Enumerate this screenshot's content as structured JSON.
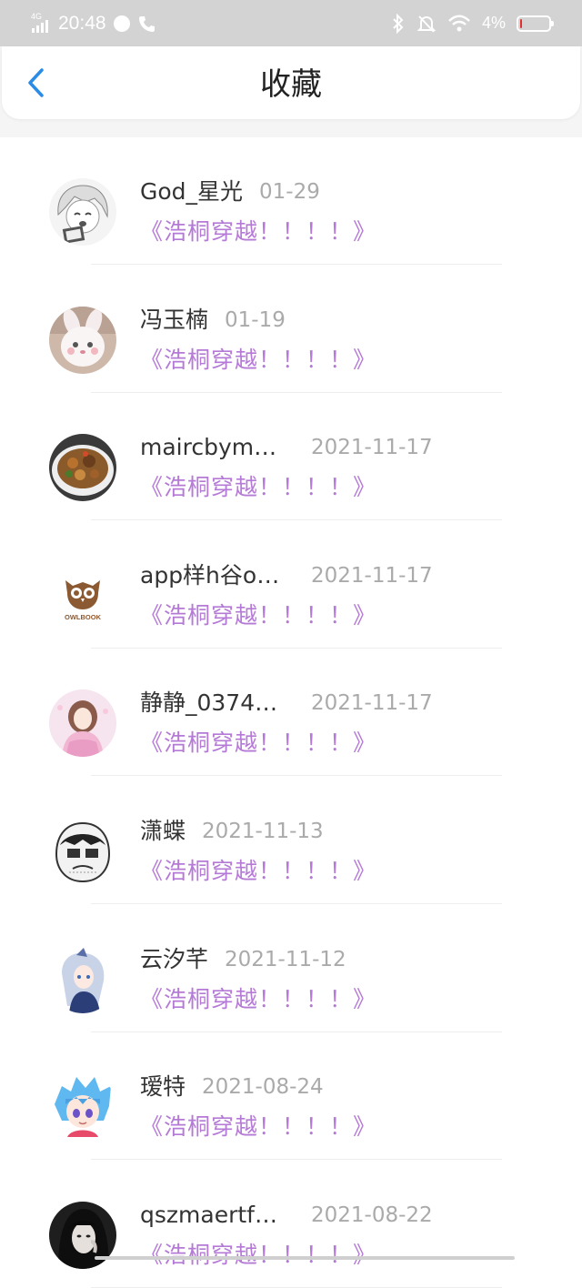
{
  "status_bar": {
    "network": "4G",
    "time": "20:48",
    "battery_percent_text": "4%",
    "battery_level": 0.04,
    "icons": [
      "signal-icon",
      "soul-app-icon",
      "phone-icon",
      "bluetooth-icon",
      "mute-icon",
      "wifi-icon",
      "battery-icon"
    ]
  },
  "header": {
    "title": "收藏",
    "back_icon": "chevron-left-icon"
  },
  "colors": {
    "accent": "#2b8ce6",
    "book_title": "#b57ad6",
    "name": "#333333",
    "date": "#aaaaaa",
    "battery_low": "#e03030"
  },
  "items": [
    {
      "name": "God_星光",
      "date": "01-29",
      "book": "《浩桐穿越！！！！》",
      "avatar": "anime-girl-sketch-avatar"
    },
    {
      "name": "冯玉楠",
      "date": "01-19",
      "book": "《浩桐穿越！！！！》",
      "avatar": "plush-bunny-avatar"
    },
    {
      "name": "maircbym…",
      "date": "2021-11-17",
      "book": "《浩桐穿越！！！！》",
      "avatar": "food-bowl-avatar"
    },
    {
      "name": "app样h谷o…",
      "date": "2021-11-17",
      "book": "《浩桐穿越！！！！》",
      "avatar": "owlbook-logo-avatar",
      "avatar_text": "OWLBOOK"
    },
    {
      "name": "静静_0374…",
      "date": "2021-11-17",
      "book": "《浩桐穿越！！！！》",
      "avatar": "anime-princess-avatar"
    },
    {
      "name": "潇蝶",
      "date": "2021-11-13",
      "book": "《浩桐穿越！！！！》",
      "avatar": "cartoon-face-avatar"
    },
    {
      "name": "云汐芊",
      "date": "2021-11-12",
      "book": "《浩桐穿越！！！！》",
      "avatar": "silver-hair-anime-avatar"
    },
    {
      "name": "瑷特",
      "date": "2021-08-24",
      "book": "《浩桐穿越！！！！》",
      "avatar": "blue-hair-anime-avatar"
    },
    {
      "name": "qszmaertf…",
      "date": "2021-08-22",
      "book": "《浩桐穿越！！！！》",
      "avatar": "dark-hair-girl-avatar"
    }
  ]
}
